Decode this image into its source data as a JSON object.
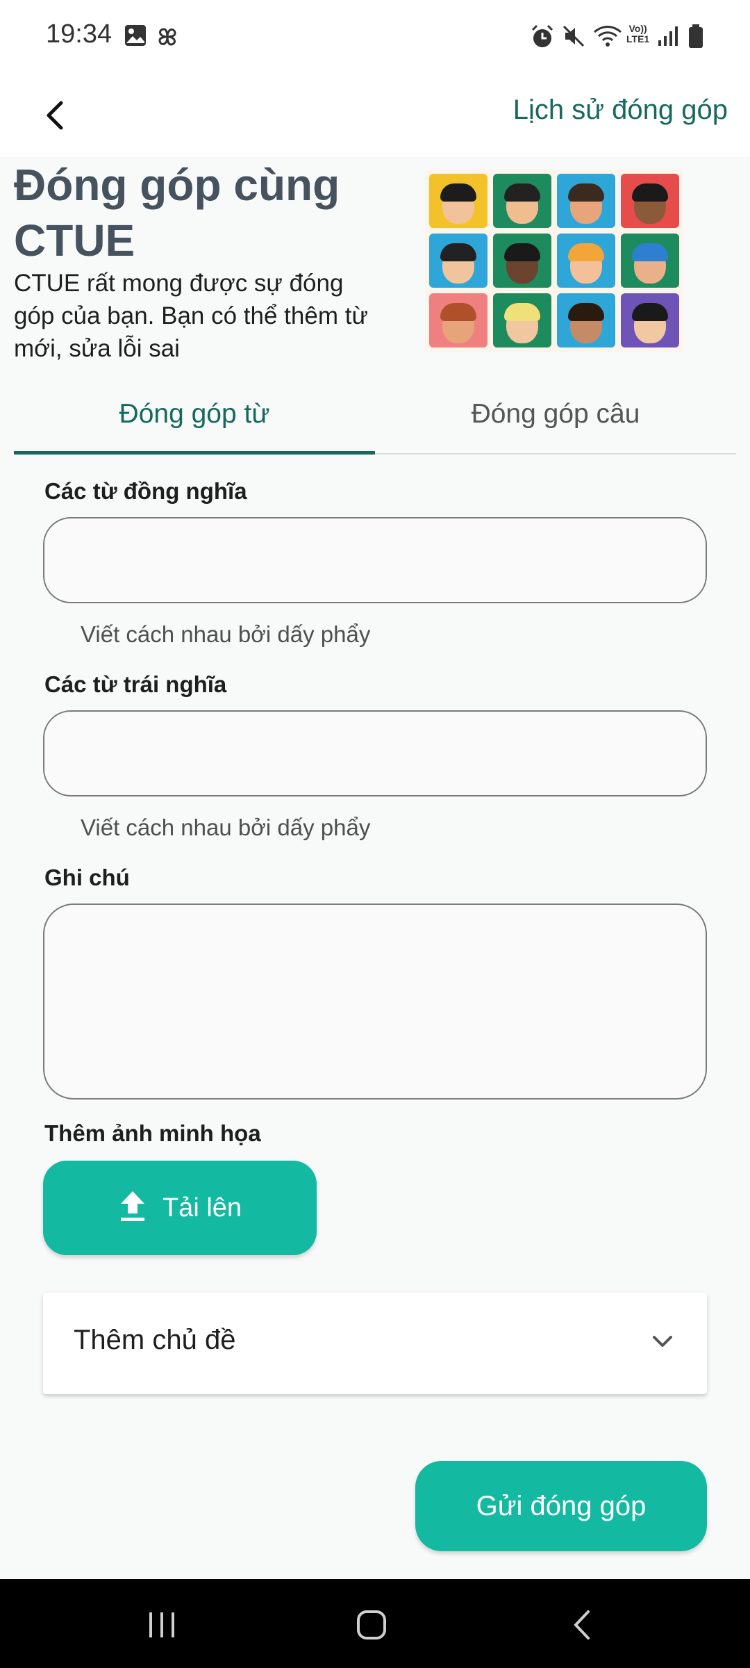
{
  "status_bar": {
    "time": "19:34",
    "network_label_top": "Vo))",
    "network_label_bottom": "LTE1"
  },
  "app_bar": {
    "back_icon": "chevron-left-icon",
    "history_link": "Lịch sử đóng góp"
  },
  "hero": {
    "title": "Đóng góp cùng CTUE",
    "description": "CTUE rất mong được sự đóng góp của bạn. Bạn có thể thêm từ mới, sửa lỗi sai"
  },
  "tabs": [
    {
      "label": "Đóng góp từ",
      "selected": true
    },
    {
      "label": "Đóng góp câu",
      "selected": false
    }
  ],
  "form": {
    "synonyms": {
      "label": "Các từ đồng nghĩa",
      "value": "",
      "helper": "Viết cách nhau bởi dấy phẩy"
    },
    "antonyms": {
      "label": "Các từ trái nghĩa",
      "value": "",
      "helper": "Viết cách nhau bởi dấy phẩy"
    },
    "note": {
      "label": "Ghi chú",
      "value": ""
    },
    "image": {
      "label": "Thêm ảnh minh họa",
      "upload_button": "Tải lên",
      "upload_icon": "upload-icon"
    },
    "topic": {
      "label": "Thêm chủ đề",
      "icon": "chevron-down-icon"
    },
    "submit_button": "Gửi đóng góp"
  },
  "colors": {
    "accent": "#17695f",
    "button": "#13b9a0",
    "title": "#46535f"
  }
}
